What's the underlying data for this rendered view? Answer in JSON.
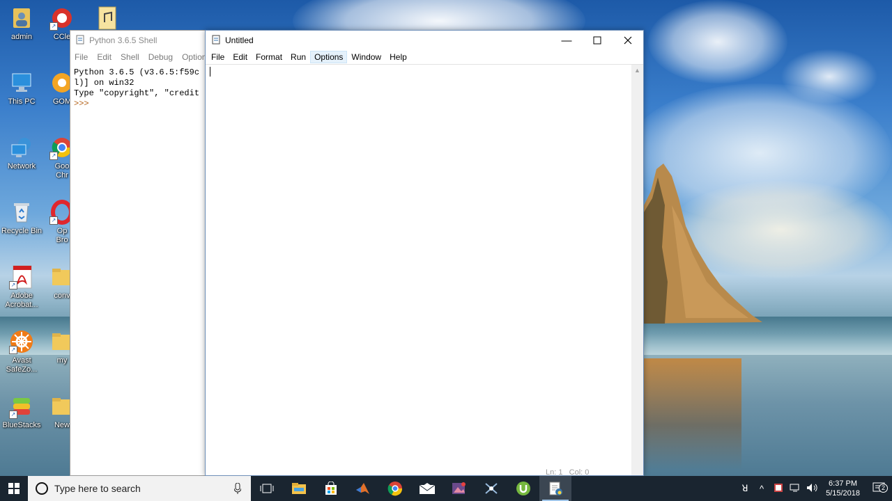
{
  "desktop": {
    "icons": [
      {
        "label": "admin",
        "icon": "user-folder-icon"
      },
      {
        "label": "CCle",
        "icon": "ccleaner-icon"
      },
      {
        "label": "",
        "icon": "audio-file-icon"
      },
      {
        "label": "This PC",
        "icon": "this-pc-icon"
      },
      {
        "label": "GOM",
        "icon": "gom-player-icon"
      },
      {
        "label": "Network",
        "icon": "network-icon"
      },
      {
        "label": "Goo\nChr",
        "icon": "chrome-icon"
      },
      {
        "label": "Recycle Bin",
        "icon": "recycle-bin-icon"
      },
      {
        "label": "Op\nBro",
        "icon": "opera-icon"
      },
      {
        "label": "Adobe\nAcrobat...",
        "icon": "adobe-acrobat-icon"
      },
      {
        "label": "conv",
        "icon": "folder-icon"
      },
      {
        "label": "Avast\nSafeZo...",
        "icon": "avast-icon"
      },
      {
        "label": "my",
        "icon": "folder-icon"
      },
      {
        "label": "BlueStacks",
        "icon": "bluestacks-icon"
      },
      {
        "label": "New",
        "icon": "folder-icon"
      }
    ]
  },
  "shell_window": {
    "title": "Python 3.6.5 Shell",
    "menu": [
      "File",
      "Edit",
      "Shell",
      "Debug",
      "Options"
    ],
    "lines": [
      "Python 3.6.5 (v3.6.5:f59c",
      "l)] on win32",
      "Type \"copyright\", \"credit"
    ],
    "prompt": ">>>"
  },
  "editor_window": {
    "title": "Untitled",
    "menu": [
      "File",
      "Edit",
      "Format",
      "Run",
      "Options",
      "Window",
      "Help"
    ],
    "active_menu": "Options",
    "content": "",
    "status": {
      "line": "Ln: 1",
      "col": "Col: 0"
    }
  },
  "taskbar": {
    "search_placeholder": "Type here to search",
    "pinned": [
      "task-view-icon",
      "file-explorer-icon",
      "store-icon",
      "matlab-icon",
      "chrome-icon",
      "mail-icon",
      "photo-app-icon",
      "snipping-icon",
      "utorrent-icon",
      "python-idle-icon"
    ],
    "active_app": "python-idle-icon",
    "time": "6:37 PM",
    "date": "5/15/2018",
    "notification_count": "2"
  }
}
